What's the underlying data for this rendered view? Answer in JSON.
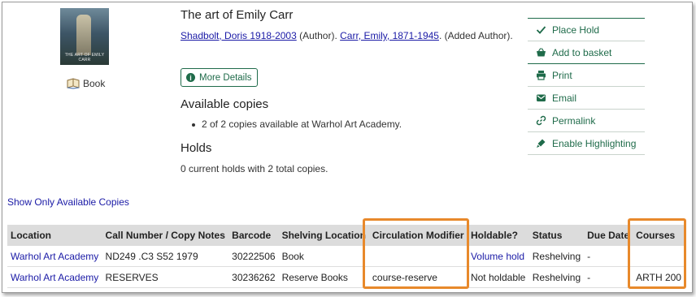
{
  "record": {
    "cover_caption": "THE ART OF EMILY CARR",
    "format": "Book",
    "title": "The art of Emily Carr",
    "author1": "Shadbolt, Doris 1918-2003",
    "author1_role": " (Author). ",
    "author2": "Carr, Emily, 1871-1945",
    "author2_role": ". (Added Author).",
    "more_details": "More Details"
  },
  "availability": {
    "heading": "Available copies",
    "summary": "2 of 2 copies available at Warhol Art Academy."
  },
  "holds": {
    "heading": "Holds",
    "summary": "0 current holds with 2 total copies."
  },
  "actions": [
    {
      "label": "Place Hold",
      "icon": "check-icon"
    },
    {
      "label": "Add to basket",
      "icon": "basket-icon"
    },
    {
      "label": "Print",
      "icon": "printer-icon"
    },
    {
      "label": "Email",
      "icon": "envelope-icon"
    },
    {
      "label": "Permalink",
      "icon": "link-icon"
    },
    {
      "label": "Enable Highlighting",
      "icon": "highlighter-icon"
    }
  ],
  "show_only_link": "Show Only Available Copies",
  "table": {
    "headers": [
      "Location",
      "Call Number / Copy Notes",
      "Barcode",
      "Shelving Location",
      "Circulation Modifier",
      "Holdable?",
      "Status",
      "Due Date",
      "Courses"
    ],
    "rows": [
      [
        "Warhol Art Academy",
        "ND249 .C3 S52 1979",
        "30222506",
        "Book",
        "",
        "Volume hold",
        "Reshelving",
        "-",
        ""
      ],
      [
        "Warhol Art Academy",
        "RESERVES",
        "30236262",
        "Reserve Books",
        "course-reserve",
        "Not holdable",
        "Reshelving",
        "-",
        "ARTH 200"
      ]
    ]
  },
  "colors": {
    "accent": "#1f6b4a",
    "link": "#1a1aa6",
    "highlight": "#e8892b",
    "header_bg": "#dcdcdc"
  }
}
